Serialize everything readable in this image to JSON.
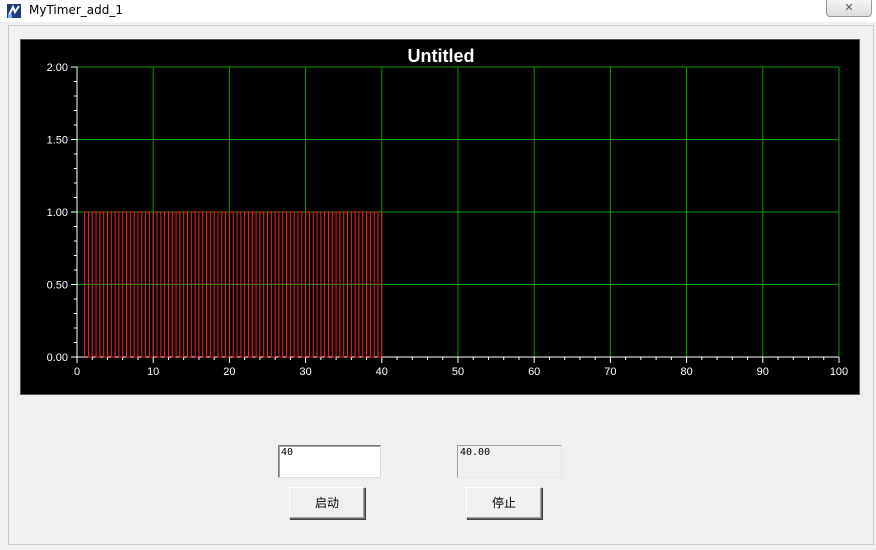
{
  "window": {
    "title": "MyTimer_add_1",
    "close_label": "✕"
  },
  "chart_data": {
    "type": "line",
    "title": "Untitled",
    "xlabel": "",
    "ylabel": "",
    "xlim": [
      0,
      100
    ],
    "ylim": [
      0,
      2
    ],
    "x_ticks": [
      "0",
      "10",
      "20",
      "30",
      "40",
      "50",
      "60",
      "70",
      "80",
      "90",
      "100"
    ],
    "y_ticks": [
      "0.00",
      "0.50",
      "1.00",
      "1.50",
      "2.00"
    ],
    "grid": true,
    "series": [
      {
        "color": "#ff2020",
        "pulse_start": 1,
        "pulse_end": 40,
        "pulse_high": 1,
        "pulse_low": 0,
        "pulse_period": 1
      }
    ],
    "colors": {
      "background": "#000000",
      "grid": "#00a000",
      "axis": "#ffffff",
      "title": "#ffffff"
    }
  },
  "controls": {
    "input_value": "40",
    "display_value": "40.00",
    "start_label": "启动",
    "stop_label": "停止"
  }
}
